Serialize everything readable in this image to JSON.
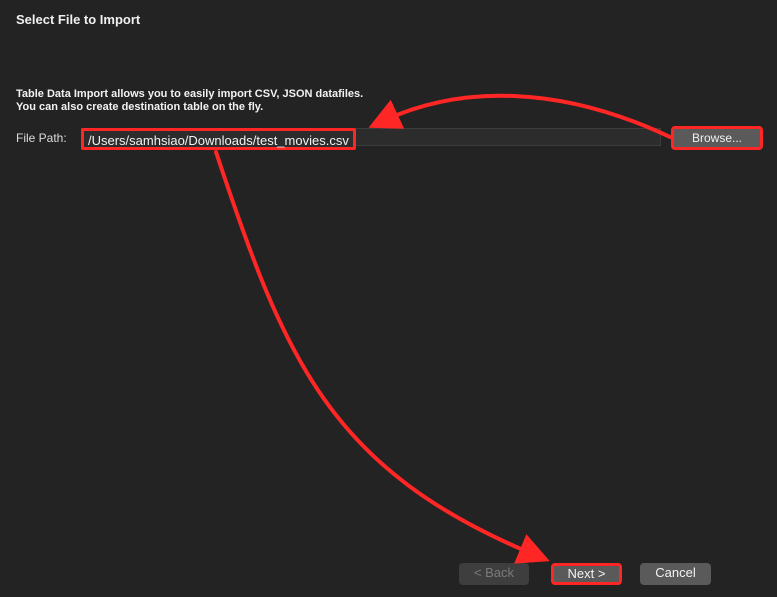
{
  "dialog": {
    "title": "Select File to Import",
    "description_line1": "Table Data Import allows you to easily import CSV, JSON datafiles.",
    "description_line2": "You can also create destination table on the fly."
  },
  "file_path": {
    "label": "File Path:",
    "value": "/Users/samhsiao/Downloads/test_movies.csv"
  },
  "buttons": {
    "browse": "Browse...",
    "back": "< Back",
    "next": "Next >",
    "cancel": "Cancel"
  },
  "colors": {
    "background": "#232323",
    "annotation": "#ff2626"
  }
}
